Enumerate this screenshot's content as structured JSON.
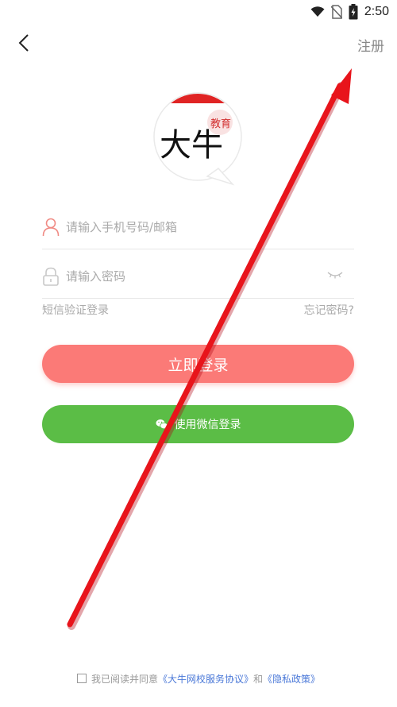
{
  "status_bar": {
    "time": "2:50",
    "icons": [
      "wifi-icon",
      "no-sim-icon",
      "battery-charging-icon"
    ]
  },
  "header": {
    "back_icon": "chevron-left-icon",
    "register_label": "注册"
  },
  "logo": {
    "main_text": "大牛",
    "seal_text": "教育"
  },
  "form": {
    "phone_placeholder": "请输入手机号码/邮箱",
    "password_placeholder": "请输入密码",
    "sms_login_label": "短信验证登录",
    "forgot_password_label": "忘记密码?"
  },
  "buttons": {
    "login_label": "立即登录",
    "wechat_label": "使用微信登录"
  },
  "agreement": {
    "prefix": "我已阅读并同意",
    "service_link": "《大牛网校服务协议》",
    "conjunction": "和",
    "privacy_link": "《隐私政策》"
  },
  "colors": {
    "login_button": "#fb7a77",
    "wechat_button": "#5bbd46",
    "link": "#4a78d8",
    "annotation_arrow": "#e8141b"
  }
}
